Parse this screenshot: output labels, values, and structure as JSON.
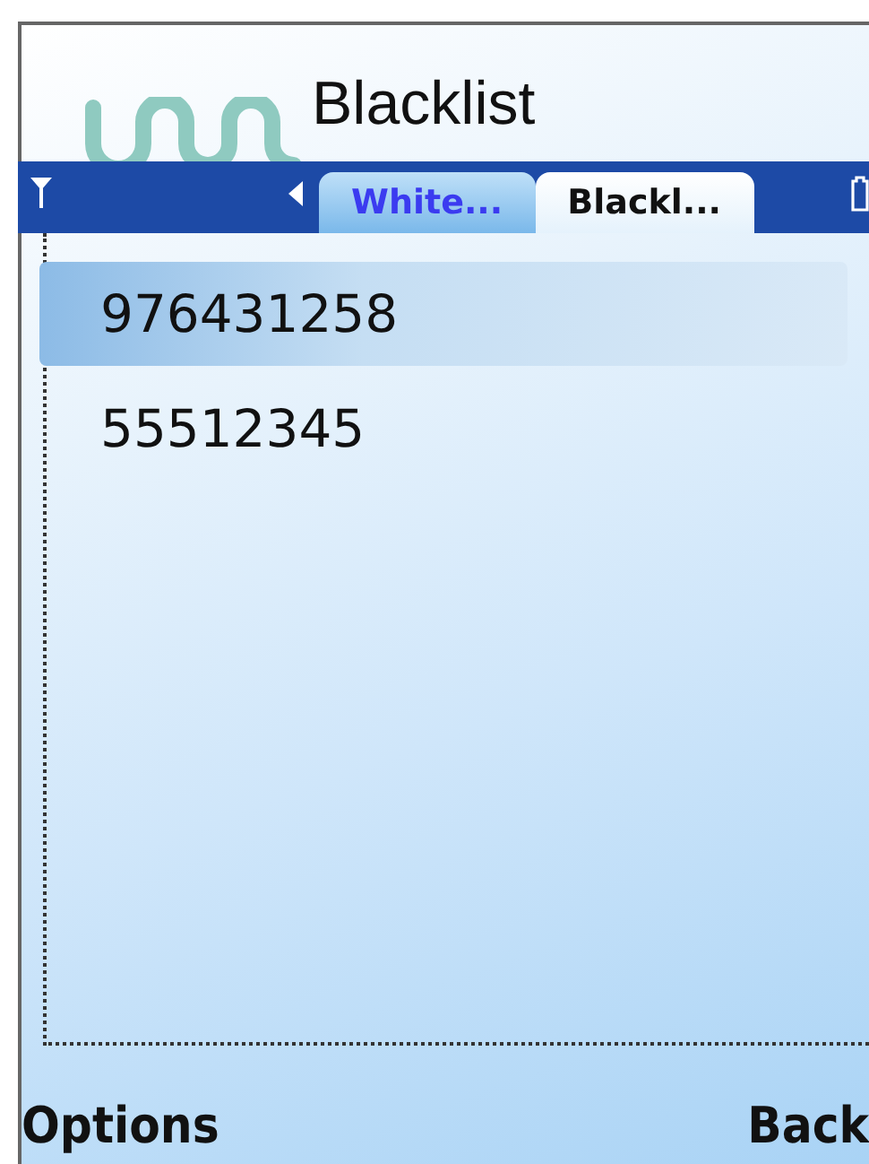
{
  "title": "Blacklist",
  "tabs": [
    {
      "label": "White...",
      "selected": false
    },
    {
      "label": "Blackl...",
      "selected": true
    }
  ],
  "list": [
    {
      "number": "976431258",
      "selected": true
    },
    {
      "number": "55512345",
      "selected": false
    }
  ],
  "softkeys": {
    "left": "Options",
    "right": "Back"
  }
}
